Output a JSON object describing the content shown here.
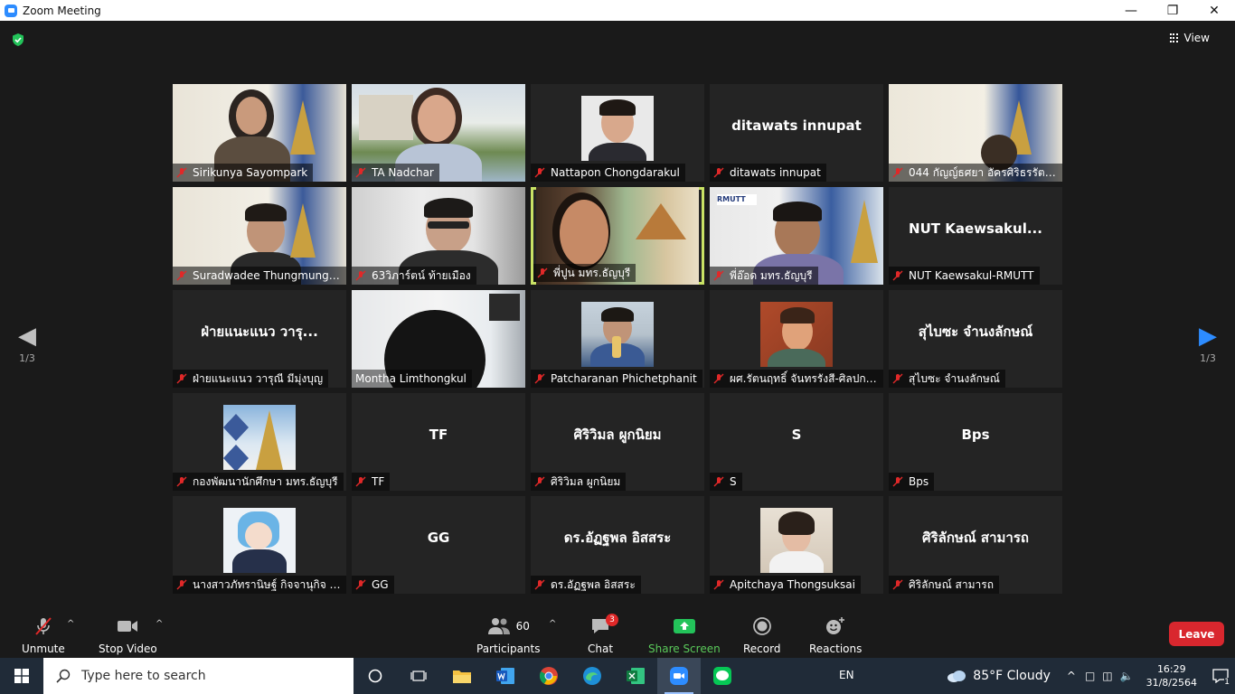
{
  "window": {
    "title": "Zoom Meeting"
  },
  "header": {
    "view_label": "View"
  },
  "nav": {
    "left_page": "1/3",
    "right_page": "1/3"
  },
  "participants": [
    {
      "name": "Sirikunya Sayompark",
      "display": ""
    },
    {
      "name": "TA Nadchar",
      "display": ""
    },
    {
      "name": "Nattapon Chongdarakul",
      "display": ""
    },
    {
      "name": "ditawats innupat",
      "display": "ditawats innupat"
    },
    {
      "name": "044 กัญญ์ธศยา อัครศิริธรรัตนา",
      "display": ""
    },
    {
      "name": "Suradwadee Thungmungm...",
      "display": ""
    },
    {
      "name": "63วิภาร์ตน์ ท้ายเมือง",
      "display": ""
    },
    {
      "name": "พี่ปูน มทร.ธัญบุรี",
      "display": ""
    },
    {
      "name": "พี่อ๊อด มทร.ธัญบุรี",
      "display": ""
    },
    {
      "name": "NUT Kaewsakul-RMUTT",
      "display": "NUT  Kaewsakul..."
    },
    {
      "name": "ฝ่ายแนะแนว วารุณี มีมุ่งบุญ",
      "display": "ฝ่ายแนะแนว วารุ..."
    },
    {
      "name": "Montha Limthongkul",
      "display": ""
    },
    {
      "name": "Patcharanan Phichetphanit",
      "display": ""
    },
    {
      "name": "ผศ.รัตนฤทธิ์ จันทรรังสี-ศิลปกรร...",
      "display": ""
    },
    {
      "name": "สุไบซะ จำนงลักษณ์",
      "display": "สุไบซะ จำนงลักษณ์"
    },
    {
      "name": "กองพัฒนานักศึกษา มทร.ธัญบุรี",
      "display": ""
    },
    {
      "name": "TF",
      "display": "TF"
    },
    {
      "name": "ศิริวิมล ผูกนิยม",
      "display": "ศิริวิมล ผูกนิยม"
    },
    {
      "name": "S",
      "display": "S"
    },
    {
      "name": "Bps",
      "display": "Bps"
    },
    {
      "name": "นางสาวภัทรานิษฐ์ กิจจานุกิจ โร...",
      "display": ""
    },
    {
      "name": "GG",
      "display": "GG"
    },
    {
      "name": "ดร.อัฏฐพล อิสสระ",
      "display": "ดร.อัฏฐพล อิสสระ"
    },
    {
      "name": "Apitchaya Thongsuksai",
      "display": ""
    },
    {
      "name": "ศิริลักษณ์ สามารถ",
      "display": "ศิริลักษณ์ สามารถ"
    }
  ],
  "toolbar": {
    "unmute": "Unmute",
    "stop_video": "Stop Video",
    "participants_count": "60",
    "participants": "Participants",
    "chat": "Chat",
    "chat_badge": "3",
    "share_screen": "Share Screen",
    "record": "Record",
    "reactions": "Reactions",
    "leave": "Leave"
  },
  "taskbar": {
    "search_placeholder": "Type here to search",
    "language": "EN",
    "weather": "85°F  Cloudy",
    "time": "16:29",
    "date": "31/8/2564",
    "notifications": "1"
  },
  "colors": {
    "zoom_blue": "#2d8cff",
    "active_speaker": "#c9e265",
    "share_green": "#5ac95a",
    "leave_red": "#d9272e"
  }
}
